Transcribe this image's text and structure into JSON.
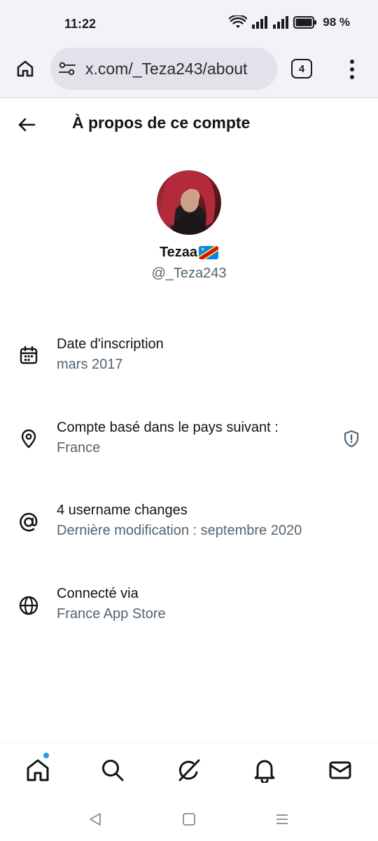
{
  "status_bar": {
    "time": "11:22",
    "battery_percent": "98 %"
  },
  "browser": {
    "url": "x.com/_Teza243/about",
    "tab_count": "4"
  },
  "header": {
    "title": "À propos de ce compte"
  },
  "profile": {
    "display_name": "Tezaa",
    "handle": "@_Teza243",
    "flag": "DR Congo flag"
  },
  "info": [
    {
      "title": "Date d'inscription",
      "value": "mars 2017",
      "icon": "calendar-icon"
    },
    {
      "title": "Compte basé dans le pays suivant :",
      "value": "France",
      "icon": "location-pin-icon",
      "badge": "shield-icon"
    },
    {
      "title": "4 username changes",
      "value": "Dernière modification : septembre 2020",
      "icon": "at-sign-icon"
    },
    {
      "title": "Connecté via",
      "value": "France App Store",
      "icon": "globe-icon"
    }
  ],
  "bottom_nav": {
    "items": [
      "home-icon",
      "search-icon",
      "grok-icon",
      "bell-icon",
      "mail-icon"
    ],
    "accent": "#1d9bf0"
  },
  "colors": {
    "primary_text": "#0f1419",
    "secondary_text": "#536471",
    "chrome_bg": "#f3f2f8"
  }
}
